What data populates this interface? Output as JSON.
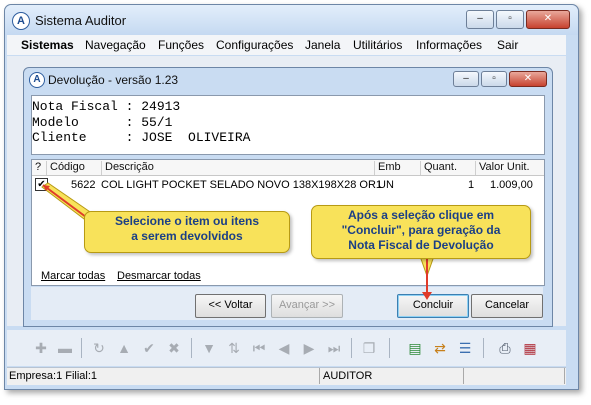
{
  "app": {
    "title": "Sistema Auditor",
    "icon_letter": "A"
  },
  "window_buttons": {
    "minimize": "–",
    "maximize": "▫",
    "close": "✕"
  },
  "menu": [
    "Sistemas",
    "Navegação",
    "Funções",
    "Configurações",
    "Janela",
    "Utilitários",
    "Informações",
    "Sair"
  ],
  "dialog": {
    "title": "Devolução - versão 1.23",
    "info_lines": [
      "Nota Fiscal : 24913",
      "Modelo      : 55/1",
      "Cliente     : JOSE  OLIVEIRA"
    ]
  },
  "grid": {
    "columns": [
      "?",
      "Código",
      "Descrição",
      "Emb",
      "Quant.",
      "Valor Unit."
    ],
    "rows": [
      {
        "checked": "✔",
        "codigo": "5622",
        "descricao": "COL LIGHT POCKET SELADO NOVO 138X198X28 OR1",
        "emb": "UN",
        "quant": "1",
        "valor": "1.009,00"
      }
    ]
  },
  "links": {
    "mark_all": "Marcar todas",
    "unmark_all": "Desmarcar todas"
  },
  "buttons": {
    "back": "<< Voltar",
    "next": "Avançar >>",
    "finish": "Concluir",
    "cancel": "Cancelar"
  },
  "callouts": {
    "select": [
      "Selecione o item ou itens",
      "a serem devolvidos"
    ],
    "finish": [
      "Após a seleção clique em",
      "\"Concluir\", para geração da",
      "Nota Fiscal de Devolução"
    ]
  },
  "toolbar_icons": [
    "plus-icon",
    "minus-icon",
    "refresh-icon",
    "up-triangle-icon",
    "check-icon",
    "x-icon",
    "filter-icon",
    "sort-icon",
    "first-icon",
    "prev-icon",
    "next-icon",
    "last-icon",
    "copy-icon",
    "export-icon",
    "import-icon",
    "list-icon",
    "print-icon",
    "calendar-icon"
  ],
  "status": {
    "empresa": "Empresa:1 Filial:1",
    "user": "AUDITOR"
  },
  "colors": {
    "callout_bg": "#f8e25a",
    "callout_text": "#1b3f86",
    "arrow": "#e03b2a"
  }
}
